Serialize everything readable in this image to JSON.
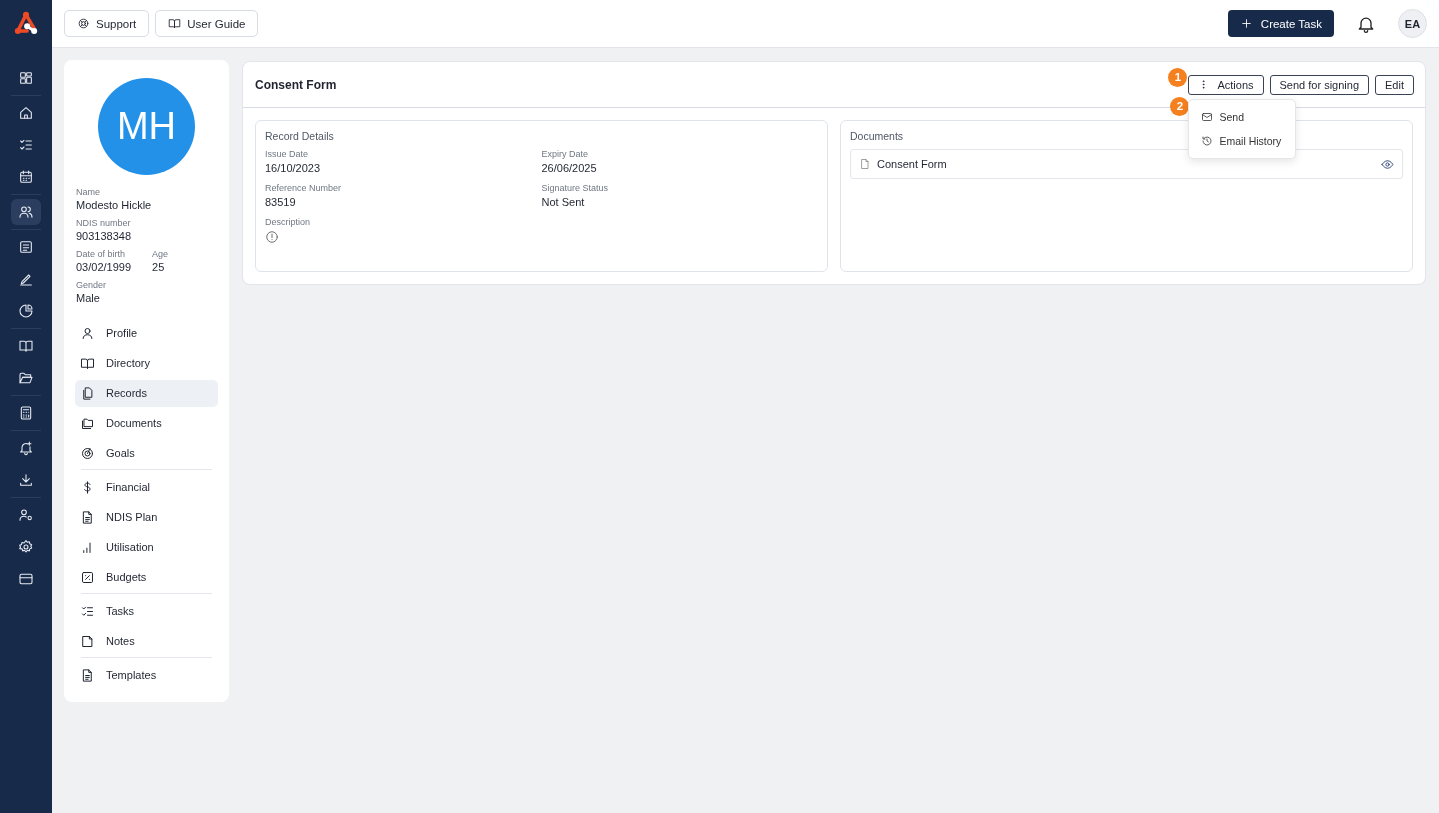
{
  "rail": {
    "groups": [
      [
        {
          "selected": false
        }
      ],
      [
        {
          "selected": false
        },
        {
          "selected": false
        },
        {
          "selected": false
        }
      ],
      [
        {
          "selected": true
        }
      ],
      [
        {
          "selected": false
        },
        {
          "selected": false
        },
        {
          "selected": false
        }
      ],
      [
        {
          "selected": false
        },
        {
          "selected": false
        }
      ],
      [
        {
          "selected": false
        }
      ],
      [
        {
          "selected": false
        },
        {
          "selected": false
        }
      ],
      [
        {
          "selected": false
        },
        {
          "selected": false
        },
        {
          "selected": false
        }
      ]
    ]
  },
  "topbar": {
    "buttons": [
      "Support",
      "User Guide"
    ],
    "create_button": "Create Task",
    "avatar": "EA"
  },
  "profile": {
    "initials": "MH",
    "fields": [
      [
        {
          "label": "Name",
          "value": "Modesto Hickle"
        }
      ],
      [
        {
          "label": "NDIS number",
          "value": "903138348"
        }
      ],
      [
        {
          "label": "Date of birth",
          "value": "03/02/1999"
        },
        {
          "label": "Age",
          "value": "25"
        }
      ],
      [
        {
          "label": "Gender",
          "value": "Male"
        }
      ]
    ],
    "menu_groups": [
      [
        {
          "label": "Profile",
          "selected": false
        },
        {
          "label": "Directory",
          "selected": false
        },
        {
          "label": "Records",
          "selected": true
        },
        {
          "label": "Documents",
          "selected": false
        },
        {
          "label": "Goals",
          "selected": false
        }
      ],
      [
        {
          "label": "Financial",
          "selected": false
        },
        {
          "label": "NDIS Plan",
          "selected": false
        },
        {
          "label": "Utilisation",
          "selected": false
        },
        {
          "label": "Budgets",
          "selected": false
        }
      ],
      [
        {
          "label": "Tasks",
          "selected": false
        },
        {
          "label": "Notes",
          "selected": false
        }
      ],
      [
        {
          "label": "Templates",
          "selected": false
        }
      ]
    ]
  },
  "record": {
    "title": "Consent Form",
    "actions_button": "Actions",
    "buttons": [
      "Send for signing",
      "Edit"
    ],
    "actions_menu": {
      "expanded": true,
      "items": [
        "Send",
        "Email History"
      ]
    },
    "callouts": [
      "1",
      "2"
    ],
    "details": {
      "title": "Record Details",
      "fields": [
        {
          "label": "Issue Date",
          "value": "16/10/2023"
        },
        {
          "label": "Expiry Date",
          "value": "26/06/2025"
        },
        {
          "label": "Reference Number",
          "value": "83519"
        },
        {
          "label": "Signature Status",
          "value": "Not Sent"
        }
      ],
      "description_label": "Description"
    },
    "documents": {
      "title": "Documents",
      "files": [
        "Consent Form"
      ]
    }
  }
}
